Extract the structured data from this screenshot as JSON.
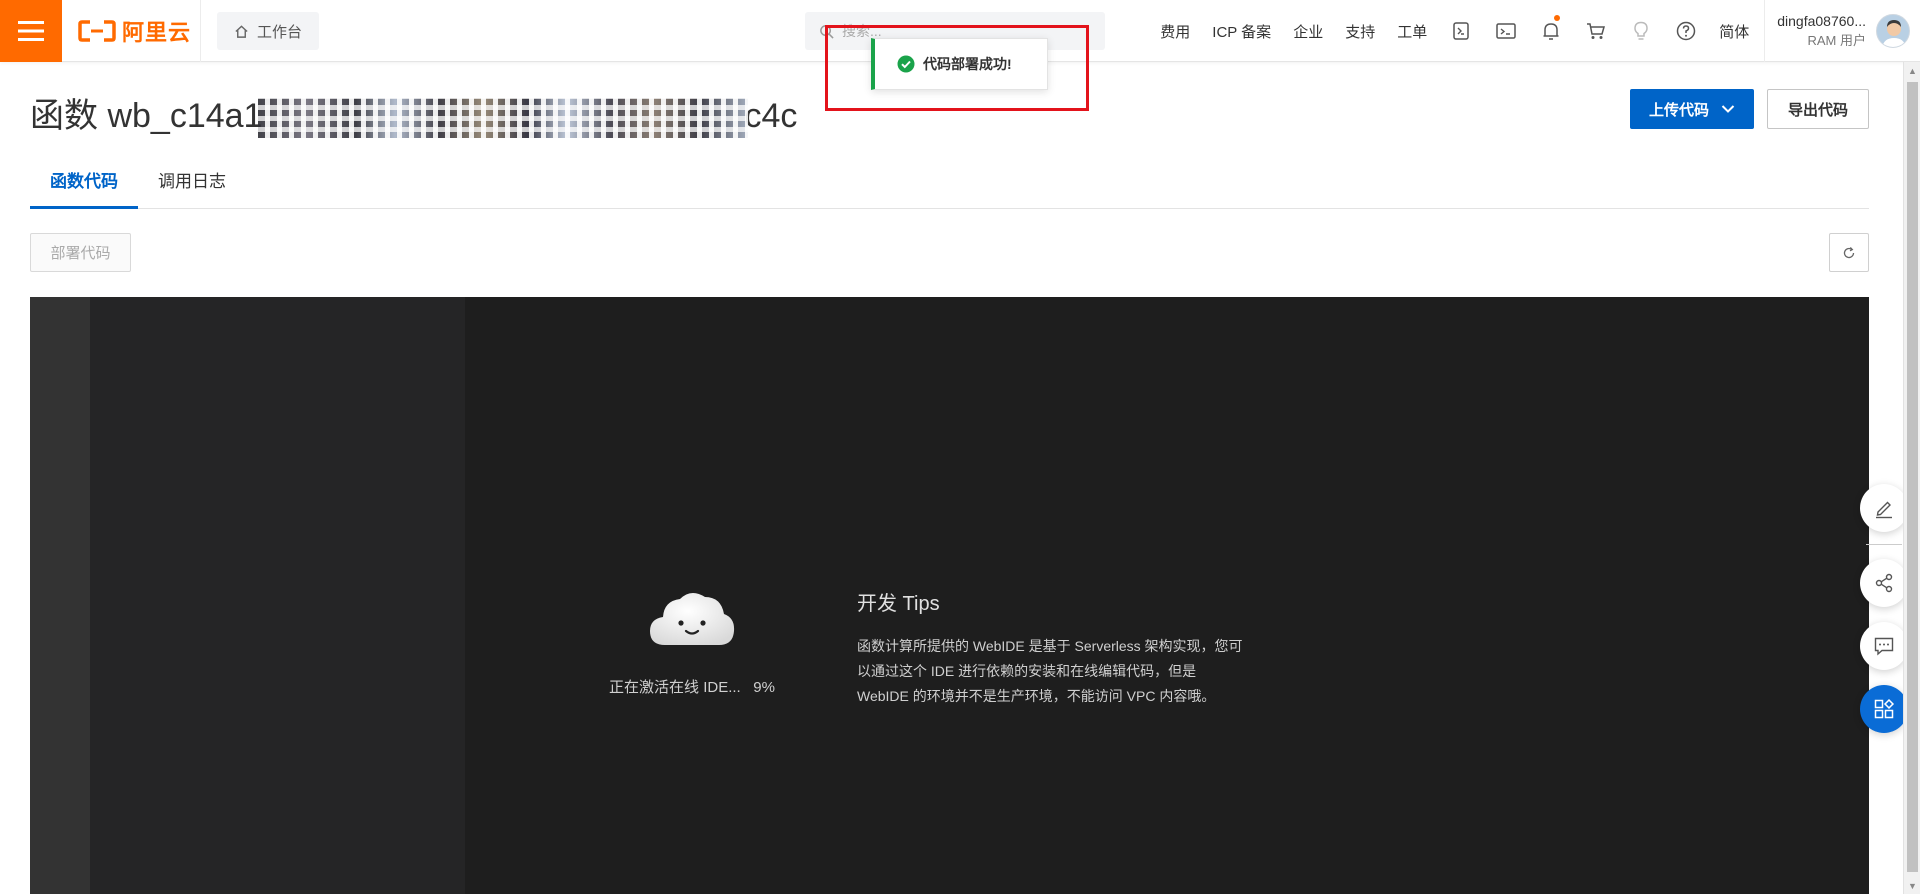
{
  "topbar": {
    "brand_text": "阿里云",
    "workbench_label": "工作台",
    "search_placeholder": "搜索...",
    "nav_links": [
      "费用",
      "ICP 备案",
      "企业",
      "支持",
      "工单"
    ],
    "lang_label": "简体",
    "user_name": "dingfa08760...",
    "user_role": "RAM 用户"
  },
  "toast": {
    "message": "代码部署成功!"
  },
  "page": {
    "title_prefix": "函数 wb_c14a1",
    "title_suffix": "c4c",
    "upload_button": "上传代码",
    "export_button": "导出代码"
  },
  "tabs": [
    {
      "label": "函数代码",
      "active": true
    },
    {
      "label": "调用日志",
      "active": false
    }
  ],
  "toolbar": {
    "deploy_button": "部署代码"
  },
  "ide": {
    "loading_text": "正在激活在线 IDE...",
    "progress": "9%",
    "tips_title": "开发 Tips",
    "tips_lines": [
      "函数计算所提供的 WebIDE 是基于 Serverless 架构实现，您可",
      "以通过这个 IDE 进行依赖的安装和在线编辑代码，但是",
      "WebIDE 的环境并不是生产环境，不能访问 VPC 内容哦。"
    ]
  },
  "colors": {
    "brand": "#ff6a00",
    "primary": "#0064c8",
    "success": "#1aa34a",
    "highlight": "#e3131b",
    "ide_bg": "#1e1e1e"
  }
}
